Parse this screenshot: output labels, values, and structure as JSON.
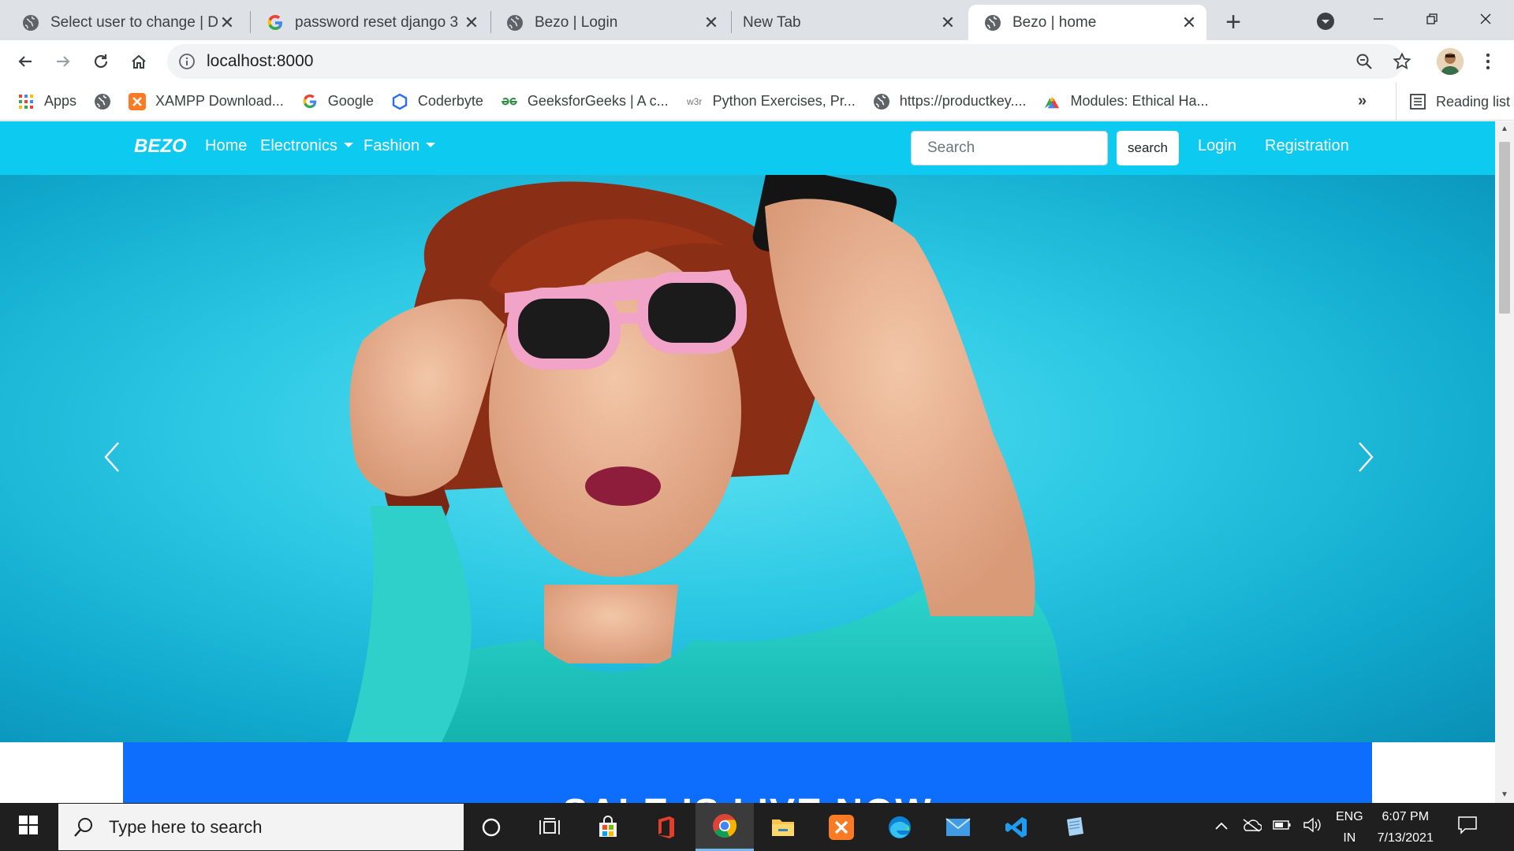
{
  "browser": {
    "tabs": [
      {
        "title": "Select user to change | Dja",
        "favicon": "globe-icon",
        "active": false
      },
      {
        "title": "password reset django 3 -",
        "favicon": "google-icon",
        "active": false
      },
      {
        "title": "Bezo | Login",
        "favicon": "globe-icon",
        "active": false
      },
      {
        "title": "New Tab",
        "favicon": "",
        "active": false
      },
      {
        "title": "Bezo | home",
        "favicon": "globe-icon",
        "active": true
      }
    ],
    "url": "localhost:8000",
    "bookmarks": {
      "apps": "Apps",
      "items": [
        {
          "label": "",
          "icon": "globe-icon"
        },
        {
          "label": "XAMPP Download...",
          "icon": "xampp-icon"
        },
        {
          "label": "Google",
          "icon": "google-icon"
        },
        {
          "label": "Coderbyte",
          "icon": "coderbyte-icon"
        },
        {
          "label": "GeeksforGeeks | A c...",
          "icon": "geeksforgeeks-icon"
        },
        {
          "label": "Python Exercises, Pr...",
          "icon": "w3resource-icon"
        },
        {
          "label": "https://productkey....",
          "icon": "globe-icon"
        },
        {
          "label": "Modules: Ethical Ha...",
          "icon": "modules-icon"
        }
      ],
      "more": "»",
      "reading_list": "Reading list"
    }
  },
  "site": {
    "brand": "BEZO",
    "nav": {
      "home": "Home",
      "electronics": "Electronics",
      "fashion": "Fashion",
      "login": "Login",
      "registration": "Registration"
    },
    "search": {
      "placeholder": "Search",
      "button": "search"
    },
    "carousel": {
      "prev_icon": "chevron-left-icon",
      "next_icon": "chevron-right-icon"
    },
    "sale_banner": "SALE IS LIVE NOW"
  },
  "taskbar": {
    "search_placeholder": "Type here to search",
    "apps": [
      "cortana-icon",
      "task-view-icon",
      "microsoft-store-icon",
      "office-icon",
      "chrome-icon",
      "file-explorer-icon",
      "xampp-icon",
      "edge-icon",
      "mail-icon",
      "vscode-icon",
      "notepad-icon"
    ],
    "language": "ENG",
    "region": "IN",
    "time": "6:07 PM",
    "date": "7/13/2021"
  },
  "colors": {
    "navbar": "#0dcaf0",
    "banner": "#0d6efd",
    "taskbar": "#1f1f1f"
  }
}
